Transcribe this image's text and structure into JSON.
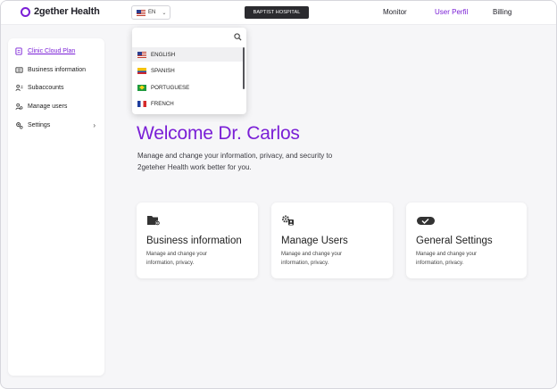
{
  "brand": {
    "name": "2gether Health",
    "accent": "#7a1fd6"
  },
  "header": {
    "language": {
      "code": "EN",
      "flag": "us-flag-icon"
    },
    "hospital": "BAPTIST HOSPITAL",
    "nav": [
      {
        "label": "Monitor",
        "active": false
      },
      {
        "label": "User Perfil",
        "active": true
      },
      {
        "label": "Billing",
        "active": false
      }
    ]
  },
  "language_menu": {
    "open": true,
    "options": [
      {
        "label": "ENGLISH",
        "flag": "us-flag-icon",
        "selected": true
      },
      {
        "label": "SPANISH",
        "flag": "colombia-flag-icon",
        "selected": false
      },
      {
        "label": "PORTUGUESE",
        "flag": "brazil-flag-icon",
        "selected": false
      },
      {
        "label": "FRENCH",
        "flag": "france-flag-icon",
        "selected": false
      }
    ]
  },
  "sidebar": {
    "items": [
      {
        "label": "Clinic Cloud Plan",
        "icon": "plan-icon",
        "active": true
      },
      {
        "label": "Business information",
        "icon": "business-icon",
        "active": false
      },
      {
        "label": "Subaccounts",
        "icon": "subaccounts-icon",
        "active": false
      },
      {
        "label": "Manage users",
        "icon": "users-icon",
        "active": false
      },
      {
        "label": "Settings",
        "icon": "settings-icon",
        "active": false,
        "has_submenu": true
      }
    ]
  },
  "main": {
    "welcome": "Welcome Dr. Carlos",
    "subtitle": "Manage and change your information, privacy, and security to 2geteher Health work better for you.",
    "cards": [
      {
        "title": "Business information",
        "description": "Manage and change your information, privacy.",
        "icon": "folder-gear-icon"
      },
      {
        "title": "Manage Users",
        "description": "Manage and change your information, privacy.",
        "icon": "users-gear-icon"
      },
      {
        "title": "General Settings",
        "description": "Manage and change your information, privacy.",
        "icon": "toggle-check-icon"
      }
    ]
  }
}
